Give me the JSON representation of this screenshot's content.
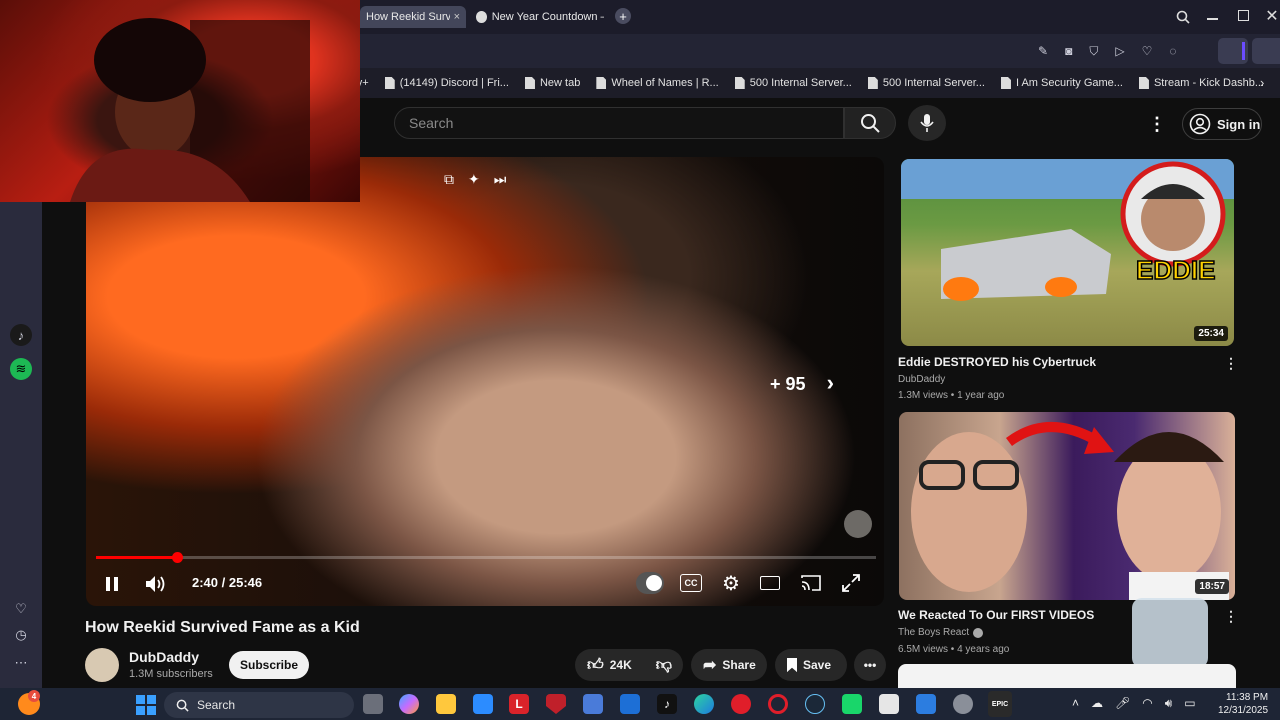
{
  "browser": {
    "tabs": [
      {
        "label": "How Reekid Survi"
      },
      {
        "label": "New Year Countdown – C"
      }
    ],
    "bookmarks": [
      {
        "label": "sney+"
      },
      {
        "label": "(14149) Discord | Fri..."
      },
      {
        "label": "New tab"
      },
      {
        "label": "Wheel of Names | R..."
      },
      {
        "label": "500 Internal Server..."
      },
      {
        "label": "500 Internal Server..."
      },
      {
        "label": "I Am Security Game..."
      },
      {
        "label": "Stream - Kick Dashb..."
      }
    ]
  },
  "youtube": {
    "search_placeholder": "Search",
    "signin_label": "Sign in",
    "player": {
      "time": "2:40 / 25:46",
      "progress_fraction": 0.1035,
      "endscreen_count": "+ 95"
    },
    "video": {
      "title": "How Reekid Survived Fame as a Kid",
      "channel": "DubDaddy",
      "subscribers": "1.3M subscribers",
      "subscribe_label": "Subscribe",
      "likes": "24K",
      "share_label": "Share",
      "save_label": "Save"
    },
    "recommendations": [
      {
        "title": "Eddie DESTROYED his Cybertruck",
        "channel": "DubDaddy",
        "meta": "1.3M views • 1 year ago",
        "duration": "25:34",
        "thumb_text": "EDDIE"
      },
      {
        "title": "We Reacted To Our FIRST VIDEOS",
        "channel": "The Boys React",
        "meta": "6.5M views • 4 years ago",
        "duration": "18:57"
      }
    ]
  },
  "taskbar": {
    "search_label": "Search",
    "time": "11:38 PM",
    "date": "12/31/2025",
    "notification_count": "4"
  },
  "colors": {
    "accent": "#ff0000",
    "page_bg": "#0f0f0f"
  }
}
